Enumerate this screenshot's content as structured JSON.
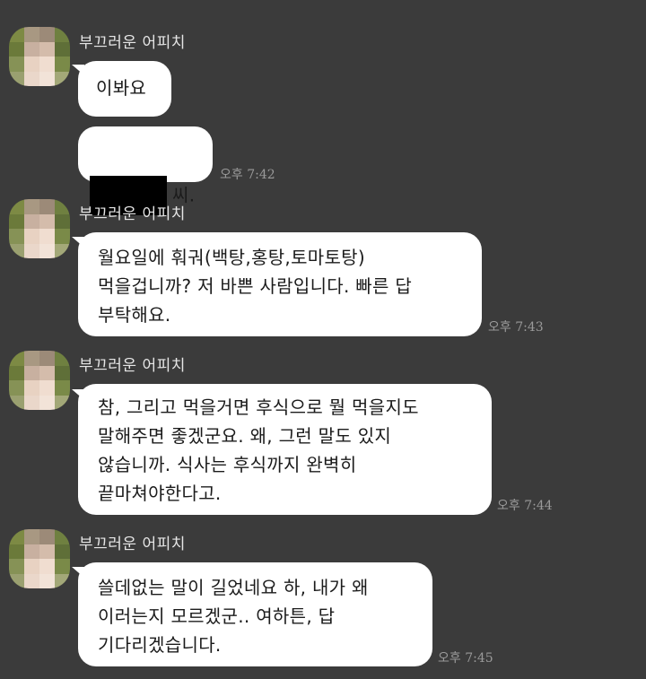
{
  "colors": {
    "background": "#3b3b3b",
    "bubble": "#ffffff",
    "text": "#1b1b1b",
    "sender": "#e6e6e6",
    "time": "#9a9a9a",
    "redaction": "#000000"
  },
  "chat": {
    "groups": [
      {
        "sender": "부끄러운 어피치",
        "messages": [
          {
            "text": "이봐요"
          },
          {
            "suffix": "씨.",
            "redacted": true,
            "time": "오후 7:42"
          }
        ]
      },
      {
        "sender": "부끄러운 어피치",
        "messages": [
          {
            "text": "월요일에 훠궈(백탕,홍탕,토마토탕)\n먹을겁니까? 저 바쁜 사람입니다. 빠른 답\n부탁해요.",
            "time": "오후 7:43"
          }
        ]
      },
      {
        "sender": "부끄러운 어피치",
        "messages": [
          {
            "text": "참, 그리고 먹을거면 후식으로 뭘 먹을지도\n말해주면 좋겠군요. 왜, 그런 말도 있지\n않습니까. 식사는 후식까지 완벽히\n끝마쳐야한다고.",
            "time": "오후 7:44"
          }
        ]
      },
      {
        "sender": "부끄러운 어피치",
        "messages": [
          {
            "text": "쓸데없는 말이 길었네요 하, 내가 왜\n이러는지 모르겠군.. 여하튼, 답\n기다리겠습니다.",
            "time": "오후 7:45"
          }
        ]
      }
    ]
  }
}
